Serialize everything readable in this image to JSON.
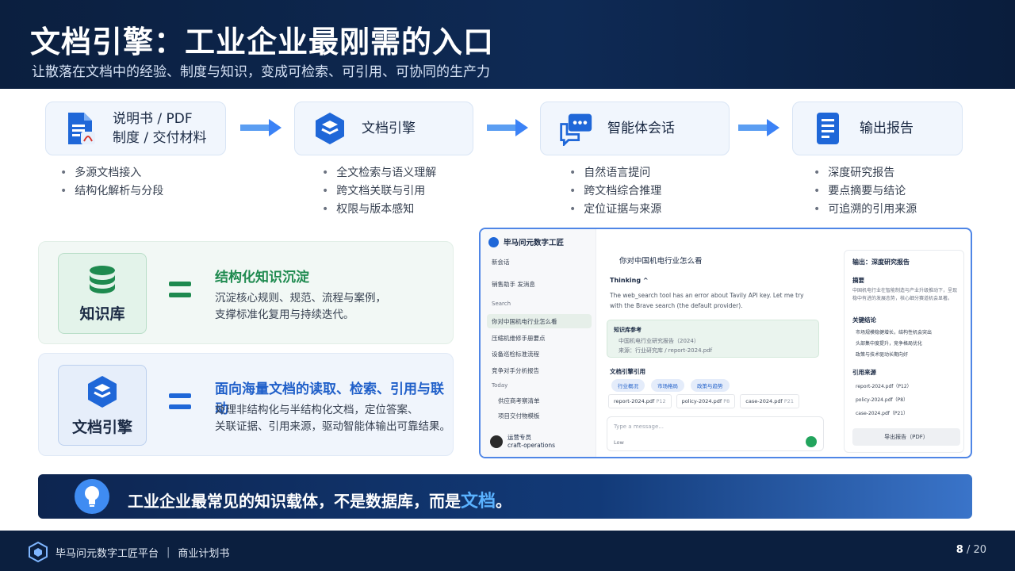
{
  "header": {
    "title": "文档引擎：工业企业最刚需的入口",
    "subtitle": "让散落在文档中的经验、制度与知识，变成可检索、可引用、可协同的生产力"
  },
  "flow": [
    {
      "label_line1": "说明书 / PDF",
      "label_line2": "制度 / 交付材料",
      "icon": "document-pdf-icon",
      "bullets": [
        "多源文档接入",
        "结构化解析与分段"
      ]
    },
    {
      "label_line1": "文档引擎",
      "label_line2": "",
      "icon": "layers-icon",
      "bullets": [
        "全文检索与语义理解",
        "跨文档关联与引用",
        "权限与版本感知"
      ]
    },
    {
      "label_line1": "智能体会话",
      "label_line2": "",
      "icon": "chat-bubble-icon",
      "bullets": [
        "自然语言提问",
        "跨文档综合推理",
        "定位证据与来源"
      ]
    },
    {
      "label_line1": "输出报告",
      "label_line2": "",
      "icon": "report-icon",
      "bullets": [
        "深度研究报告",
        "要点摘要与结论",
        "可追溯的引用来源"
      ]
    }
  ],
  "features": [
    {
      "badge": "知识库",
      "title": "结构化知识沉淀",
      "desc1": "沉淀核心规则、规范、流程与案例，",
      "desc2": "支撑标准化复用与持续迭代。"
    },
    {
      "badge": "文档引擎",
      "title": "面向海量文档的读取、检索、引用与联动",
      "desc1": "处理非结构化与半结构化文档，定位答案、",
      "desc2": "关联证据、引用来源，驱动智能体输出可靠结果。"
    }
  ],
  "app": {
    "brand": "毕马问元数字工匠",
    "new_chat": "新会话",
    "assistant": "销售助手 发消息",
    "search_label": "Search",
    "chats": [
      "你对中国机电行业怎么看",
      "压缩机维修手册要点",
      "设备巡检标准流程",
      "竞争对手分析报告"
    ],
    "today_label": "Today",
    "today_chats": [
      "供应商考察清单",
      "项目交付物模板"
    ],
    "user_name": "运营专员",
    "user_handle": "craft-operations",
    "question": "你对中国机电行业怎么看",
    "thinking_label": "Thinking ^",
    "thinking_text": "The web_search tool has an error about Tavily API key. Let me try with the Brave search (the default provider).",
    "kb_title": "知识库参考",
    "kb_line1": "中国机电行业研究报告（2024）",
    "kb_line2": "来源：行业研究库 / report-2024.pdf",
    "ref_title": "文档引擎引用",
    "tags": [
      "行业概况",
      "市场格局",
      "政策与趋势"
    ],
    "files": [
      {
        "name": "report-2024.pdf",
        "page": "P12"
      },
      {
        "name": "policy-2024.pdf",
        "page": "P8"
      },
      {
        "name": "case-2024.pdf",
        "page": "P21"
      }
    ],
    "input_placeholder": "Type a message...",
    "effort": "Low",
    "output_header": "输出：深度研究报告",
    "summary_title": "摘要",
    "summary_text": "中国机电行业在智能制造与产业升级推动下，呈现稳中有进的发展态势，核心细分赛道机会显著。",
    "key_title": "关键结论",
    "key_points": [
      "市场规模稳健增长，结构性机会突出",
      "头部集中度提升，竞争格局优化",
      "政策与技术驱动长期向好"
    ],
    "cite_title": "引用来源",
    "cites": [
      "report-2024.pdf（P12）",
      "policy-2024.pdf（P8）",
      "case-2024.pdf（P21）"
    ],
    "export_label": "导出报告（PDF）"
  },
  "banner": {
    "text_before": "工业企业最常见的知识载体，不是数据库，而是",
    "highlight": "文档",
    "text_after": "。"
  },
  "footer": {
    "brand": "毕马问元数字工匠平台",
    "divider": "|",
    "doc": "商业计划书",
    "page": "8",
    "total": "/ 20"
  },
  "colors": {
    "primary": "#1f67d8",
    "green": "#1e8a4f",
    "navy": "#0b1f3f"
  }
}
